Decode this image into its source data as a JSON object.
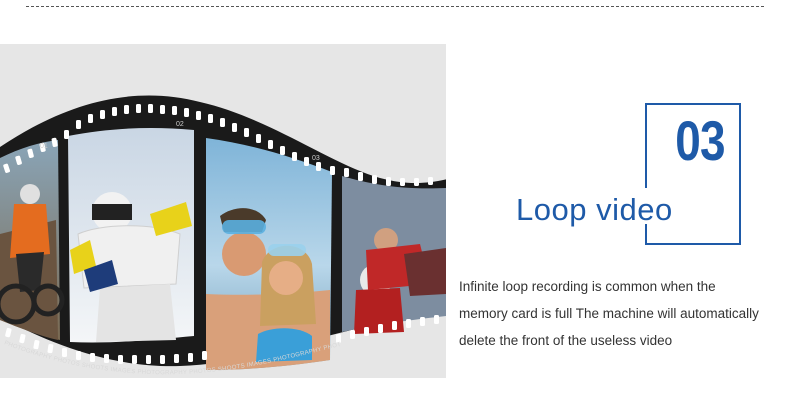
{
  "feature": {
    "number": "03",
    "title": "Loop video",
    "description_lines": [
      "Infinite loop recording is common when the",
      "memory card is full The machine will automatically",
      "delete the front of the useless video"
    ]
  },
  "film_strip": {
    "frame_numbers": [
      "01",
      "02",
      "03"
    ],
    "edge_text": "PHOTOGRAPHY PHOTOS SHOOTS IMAGES PHOTOGRAPHY PHOTOS SHOOTS IMAGES PHOTOGRAPHY PHOTOS"
  },
  "colors": {
    "accent": "#1e5aa8",
    "text": "#333333",
    "panel_bg": "#e6e6e6",
    "film": "#1a1a1a"
  }
}
